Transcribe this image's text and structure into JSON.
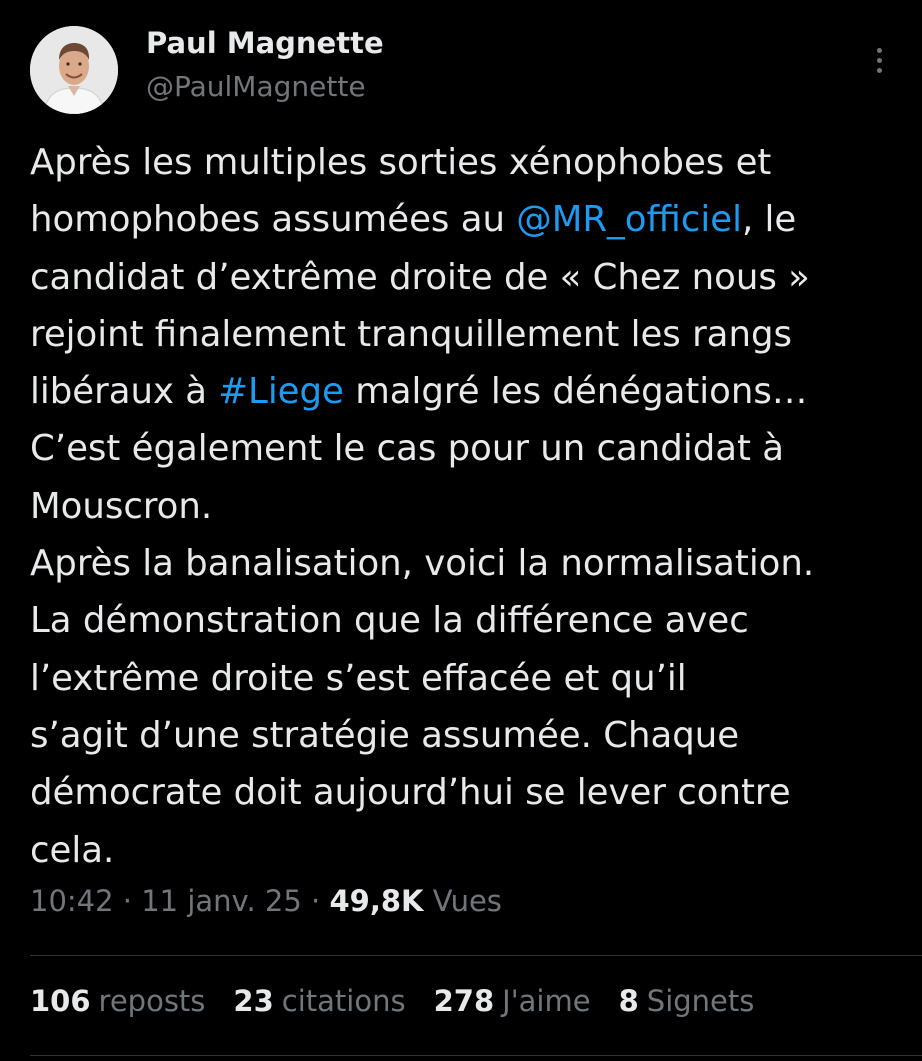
{
  "author": {
    "display_name": "Paul Magnette",
    "handle": "@PaulMagnette"
  },
  "tweet": {
    "lines": [
      [
        {
          "text": "Après les multiples sorties xénophobes et"
        }
      ],
      [
        {
          "text": "homophobes assumées au "
        },
        {
          "text": "@MR_officiel",
          "link": true
        },
        {
          "text": ", le"
        }
      ],
      [
        {
          "text": "candidat d’extrême droite de « Chez nous »"
        }
      ],
      [
        {
          "text": "rejoint finalement tranquillement les rangs"
        }
      ],
      [
        {
          "text": "libéraux à "
        },
        {
          "text": "#Liege",
          "link": true
        },
        {
          "text": " malgré les dénégations…"
        }
      ],
      [
        {
          "text": "C’est également le cas pour un candidat à"
        }
      ],
      [
        {
          "text": "Mouscron."
        }
      ],
      [
        {
          "text": "Après la banalisation, voici la normalisation."
        }
      ],
      [
        {
          "text": "La démonstration que la différence avec"
        }
      ],
      [
        {
          "text": "l’extrême droite s’est effacée et qu’il"
        }
      ],
      [
        {
          "text": "s’agit d’une stratégie assumée. Chaque"
        }
      ],
      [
        {
          "text": "démocrate doit aujourd’hui se lever contre"
        }
      ],
      [
        {
          "text": "cela."
        }
      ]
    ]
  },
  "meta": {
    "time": "10:42",
    "separator": " · ",
    "date": "11 janv. 25",
    "views_count": "49,8K",
    "views_label": " Vues"
  },
  "stats": {
    "reposts_count": "106",
    "reposts_label": "reposts",
    "quotes_count": "23",
    "quotes_label": "citations",
    "likes_count": "278",
    "likes_label": "J'aime",
    "bookmarks_count": "8",
    "bookmarks_label": "Signets"
  },
  "colors": {
    "background": "#000000",
    "text": "#e7e9ea",
    "secondary": "#71767b",
    "link": "#1d9bf0",
    "divider": "#2f3336"
  },
  "icons": {
    "more": "more-vertical-icon"
  }
}
